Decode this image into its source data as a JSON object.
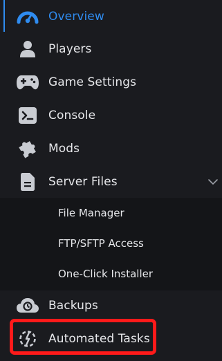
{
  "sidebar": {
    "items": [
      {
        "label": "Overview",
        "icon": "speedometer-icon",
        "active": true
      },
      {
        "label": "Players",
        "icon": "user-icon"
      },
      {
        "label": "Game Settings",
        "icon": "gamepad-icon"
      },
      {
        "label": "Console",
        "icon": "terminal-icon"
      },
      {
        "label": "Mods",
        "icon": "puzzle-icon"
      },
      {
        "label": "Server Files",
        "icon": "file-icon",
        "expanded": true
      },
      {
        "label": "Backups",
        "icon": "cloud-backup-icon"
      },
      {
        "label": "Automated Tasks",
        "icon": "automation-icon",
        "highlighted": true
      }
    ],
    "server_files_submenu": [
      {
        "label": "File Manager"
      },
      {
        "label": "FTP/SFTP Access"
      },
      {
        "label": "One-Click Installer"
      }
    ]
  },
  "colors": {
    "background": "#1a1b1f",
    "submenu_background": "#141518",
    "active": "#2f8cf0",
    "text": "#e6e7ea",
    "icon": "#c9ccd2",
    "highlight": "#ff1a1a"
  }
}
